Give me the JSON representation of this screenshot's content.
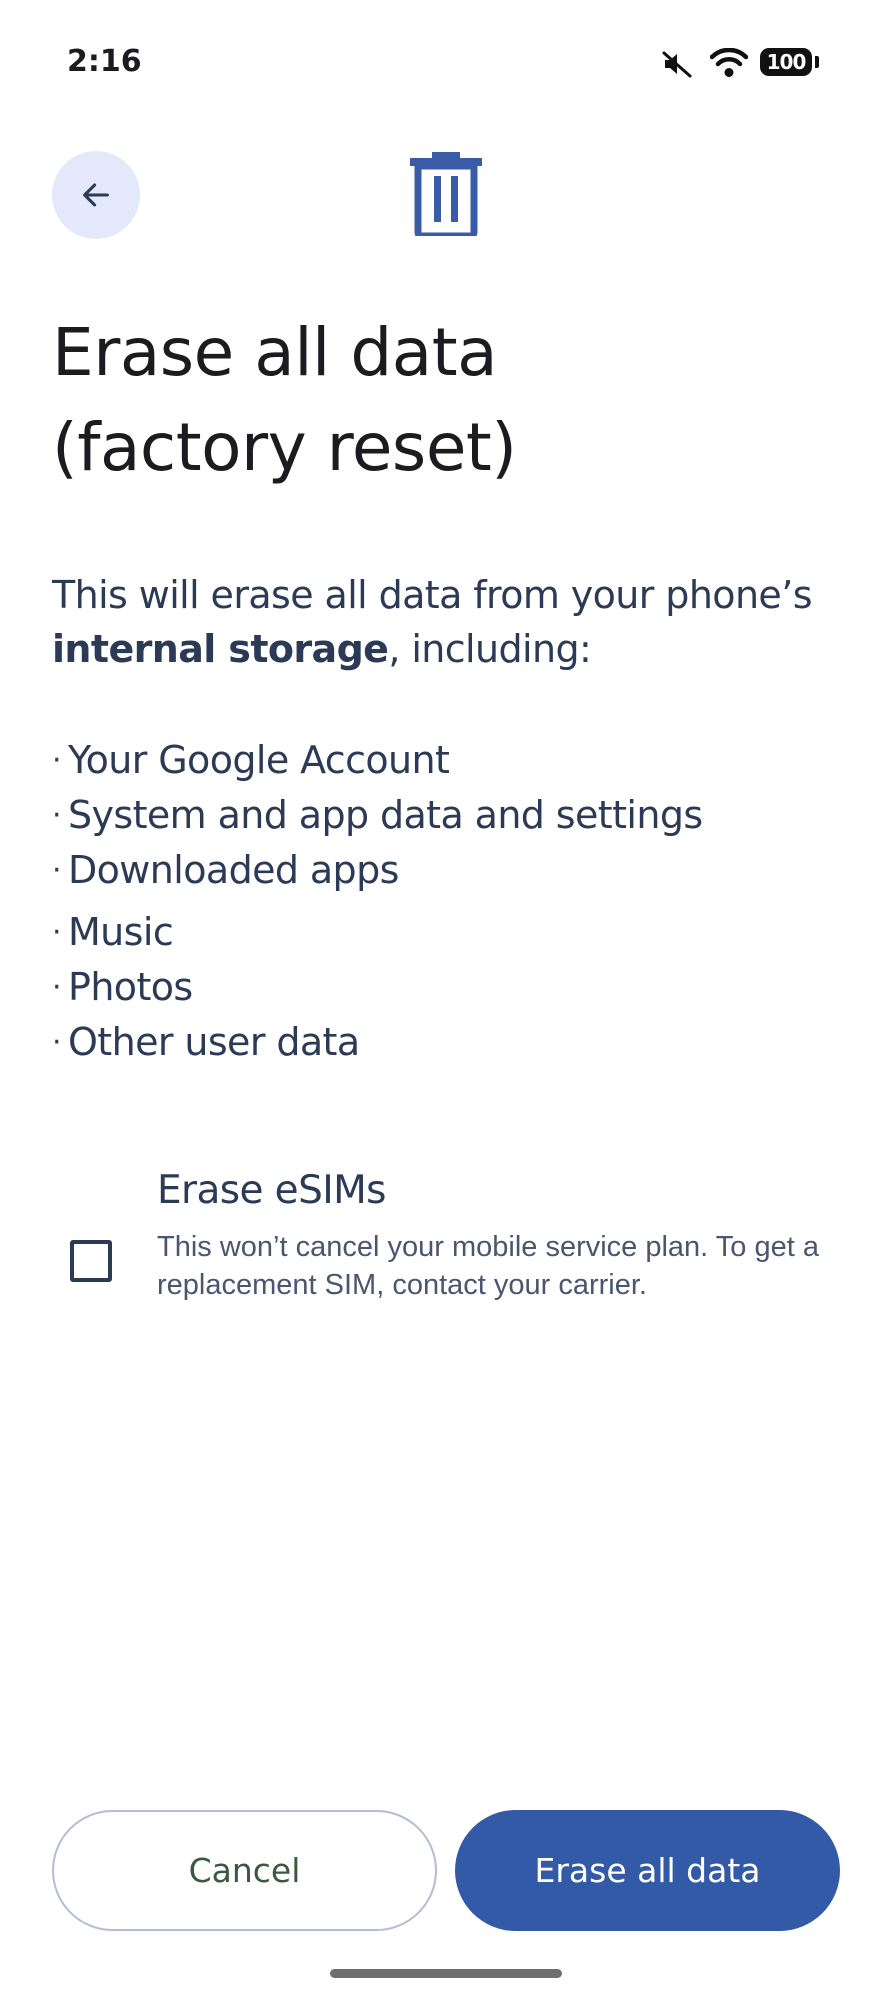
{
  "status_bar": {
    "time": "2:16",
    "battery_level": "100",
    "icons": [
      "mute-icon",
      "wifi-icon",
      "battery-icon"
    ]
  },
  "header": {
    "back_icon": "arrow-back-icon",
    "page_icon": "trash-icon"
  },
  "title": {
    "line1": "Erase all data",
    "line2": "(factory reset)"
  },
  "intro": {
    "part1": "This will erase all data from your phone’s ",
    "bold": "internal storage",
    "part2": ", including:"
  },
  "items": [
    "Your Google Account",
    "System and app data and settings",
    "Downloaded apps",
    "Music",
    "Photos",
    "Other user data"
  ],
  "esim": {
    "checked": false,
    "title": "Erase eSIMs",
    "description": "This won’t cancel your mobile service plan. To get a replacement SIM, contact your carrier."
  },
  "buttons": {
    "cancel": "Cancel",
    "erase": "Erase all data"
  },
  "colors": {
    "accent": "#335aa6",
    "back_button_bg": "#e3e9fb",
    "icon": "#3a5ca8"
  }
}
